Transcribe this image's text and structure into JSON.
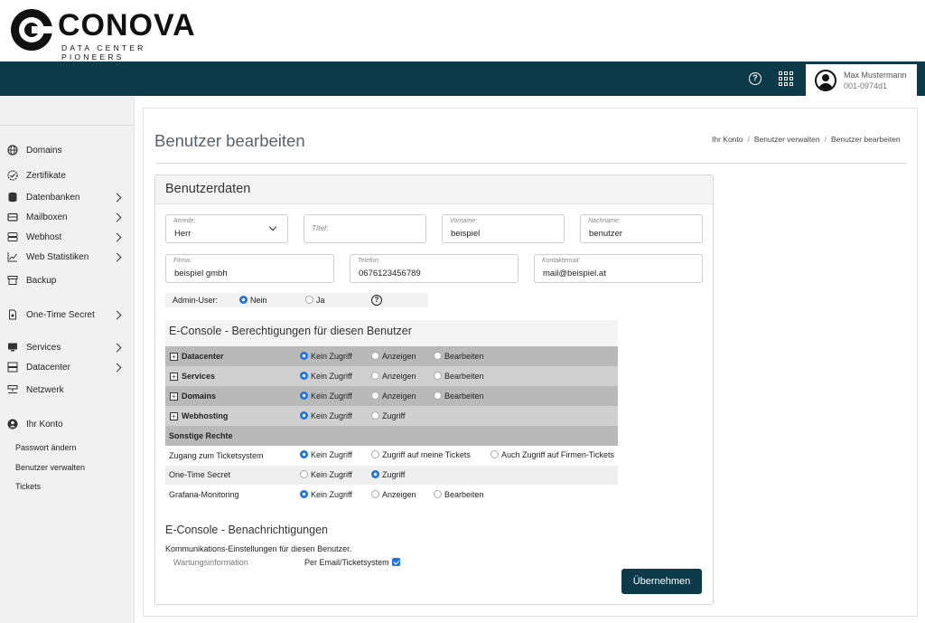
{
  "logo": {
    "word": "CONOVA",
    "tagline": "DATA CENTER PIONEERS"
  },
  "header": {
    "help_icon": "?",
    "user_name": "Max Mustermann",
    "user_id": "001-0974d1"
  },
  "sidebar": {
    "items": [
      {
        "label": "Domains",
        "icon": "globe-icon"
      },
      {
        "label": "Zertifikate",
        "icon": "certificate-icon"
      },
      {
        "label": "Datenbanken",
        "icon": "database-icon"
      },
      {
        "label": "Mailboxen",
        "icon": "mailbox-icon"
      },
      {
        "label": "Webhost",
        "icon": "server-icon"
      },
      {
        "label": "Web Statistiken",
        "icon": "chart-icon"
      },
      {
        "label": "Backup",
        "icon": "archive-icon"
      },
      {
        "label": "One-Time Secret",
        "icon": "secret-file-icon"
      },
      {
        "label": "Services",
        "icon": "monitor-icon"
      },
      {
        "label": "Datacenter",
        "icon": "server-stack-icon"
      },
      {
        "label": "Netzwerk",
        "icon": "network-icon"
      },
      {
        "label": "Ihr Konto",
        "icon": "user-icon"
      }
    ],
    "subitems": [
      "Passwort ändern",
      "Benutzer verwalten",
      "Tickets"
    ]
  },
  "page": {
    "title": "Benutzer bearbeiten"
  },
  "breadcrumb": [
    "Ihr Konto",
    "Benutzer verwalten",
    "Benutzer bearbeiten"
  ],
  "breadcrumb_sep": "/",
  "card": {
    "title": "Benutzerdaten"
  },
  "fields": {
    "anrede": {
      "label": "Anrede:",
      "value": "Herr"
    },
    "titel": {
      "label": "Titel:",
      "value": ""
    },
    "vorname": {
      "label": "Vorname:",
      "value": "beispiel"
    },
    "nachname": {
      "label": "Nachname:",
      "value": "benutzer"
    },
    "firma": {
      "label": "Firma:",
      "value": "beispiel gmbh"
    },
    "telefon": {
      "label": "Telefon:",
      "value": "0676123456789"
    },
    "email": {
      "label": "Kontaktemail:",
      "value": "mail@beispiel.at"
    }
  },
  "admin": {
    "label": "Admin-User:",
    "options": [
      "Nein",
      "Ja"
    ],
    "selected": "Nein",
    "help": "?"
  },
  "permissions": {
    "title": "E-Console - Berechtigungen für diesen Benutzer",
    "expand_glyph": "+",
    "groups": [
      {
        "name": "Datacenter",
        "options": [
          "Kein Zugriff",
          "Anzeigen",
          "Bearbeiten"
        ],
        "selected": 0
      },
      {
        "name": "Services",
        "options": [
          "Kein Zugriff",
          "Anzeigen",
          "Bearbeiten"
        ],
        "selected": 0
      },
      {
        "name": "Domains",
        "options": [
          "Kein Zugriff",
          "Anzeigen",
          "Bearbeiten"
        ],
        "selected": 0
      },
      {
        "name": "Webhosting",
        "options": [
          "Kein Zugriff",
          "Zugriff"
        ],
        "selected": 0
      }
    ],
    "other_title": "Sonstige Rechte",
    "other": [
      {
        "name": "Zugang zum Ticketsystem",
        "options": [
          "Kein Zugriff",
          "Zugriff auf meine Tickets",
          "Auch Zugriff auf Firmen-Tickets"
        ],
        "selected": 0
      },
      {
        "name": "One-Time Secret",
        "options": [
          "Kein Zugriff",
          "Zugriff"
        ],
        "selected": 1
      },
      {
        "name": "Grafana-Monitoring",
        "options": [
          "Kein Zugriff",
          "Anzeigen",
          "Bearbeiten"
        ],
        "selected": 0
      }
    ]
  },
  "notifications": {
    "title": "E-Console - Benachrichtigungen",
    "description": "Kommunikations-Einstellungen für diesen Benutzer.",
    "item_label": "Wartungsinformation",
    "item_option": "Per Email/Ticketsystem",
    "item_checked": true
  },
  "actions": {
    "save_label": "Übernehmen"
  },
  "colors": {
    "brand": "#0d3a48",
    "accent": "#1a73e8"
  }
}
